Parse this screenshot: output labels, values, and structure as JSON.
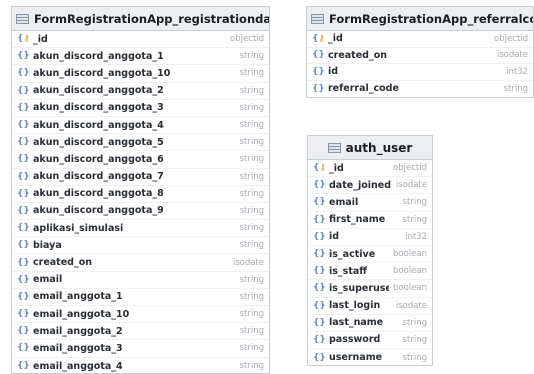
{
  "tables": [
    {
      "id": "registration",
      "title": "FormRegistrationApp_registrationdata",
      "fields": [
        {
          "name": "_id",
          "type": "objectid",
          "icon": "key-icon"
        },
        {
          "name": "akun_discord_anggota_1",
          "type": "string",
          "icon": "braces-icon"
        },
        {
          "name": "akun_discord_anggota_10",
          "type": "string",
          "icon": "braces-icon"
        },
        {
          "name": "akun_discord_anggota_2",
          "type": "string",
          "icon": "braces-icon"
        },
        {
          "name": "akun_discord_anggota_3",
          "type": "string",
          "icon": "braces-icon"
        },
        {
          "name": "akun_discord_anggota_4",
          "type": "string",
          "icon": "braces-icon"
        },
        {
          "name": "akun_discord_anggota_5",
          "type": "string",
          "icon": "braces-icon"
        },
        {
          "name": "akun_discord_anggota_6",
          "type": "string",
          "icon": "braces-icon"
        },
        {
          "name": "akun_discord_anggota_7",
          "type": "string",
          "icon": "braces-icon"
        },
        {
          "name": "akun_discord_anggota_8",
          "type": "string",
          "icon": "braces-icon"
        },
        {
          "name": "akun_discord_anggota_9",
          "type": "string",
          "icon": "braces-icon"
        },
        {
          "name": "aplikasi_simulasi",
          "type": "string",
          "icon": "braces-icon"
        },
        {
          "name": "biaya",
          "type": "string",
          "icon": "braces-icon"
        },
        {
          "name": "created_on",
          "type": "isodate",
          "icon": "braces-icon"
        },
        {
          "name": "email",
          "type": "string",
          "icon": "braces-icon"
        },
        {
          "name": "email_anggota_1",
          "type": "string",
          "icon": "braces-icon"
        },
        {
          "name": "email_anggota_10",
          "type": "string",
          "icon": "braces-icon"
        },
        {
          "name": "email_anggota_2",
          "type": "string",
          "icon": "braces-icon"
        },
        {
          "name": "email_anggota_3",
          "type": "string",
          "icon": "braces-icon"
        },
        {
          "name": "email_anggota_4",
          "type": "string",
          "icon": "braces-icon"
        }
      ]
    },
    {
      "id": "referral",
      "title": "FormRegistrationApp_referralcode",
      "fields": [
        {
          "name": "_id",
          "type": "objectid",
          "icon": "key-icon"
        },
        {
          "name": "created_on",
          "type": "isodate",
          "icon": "braces-icon"
        },
        {
          "name": "id",
          "type": "int32",
          "icon": "braces-icon"
        },
        {
          "name": "referral_code",
          "type": "string",
          "icon": "braces-icon"
        }
      ]
    },
    {
      "id": "auth_user",
      "title": "auth_user",
      "fields": [
        {
          "name": "_id",
          "type": "objectid",
          "icon": "key-icon"
        },
        {
          "name": "date_joined",
          "type": "isodate",
          "icon": "braces-icon"
        },
        {
          "name": "email",
          "type": "string",
          "icon": "braces-icon"
        },
        {
          "name": "first_name",
          "type": "string",
          "icon": "braces-icon"
        },
        {
          "name": "id",
          "type": "int32",
          "icon": "braces-icon"
        },
        {
          "name": "is_active",
          "type": "boolean",
          "icon": "braces-icon"
        },
        {
          "name": "is_staff",
          "type": "boolean",
          "icon": "braces-icon"
        },
        {
          "name": "is_superuser",
          "type": "boolean",
          "icon": "braces-icon"
        },
        {
          "name": "last_login",
          "type": "isodate",
          "icon": "braces-icon"
        },
        {
          "name": "last_name",
          "type": "string",
          "icon": "braces-icon"
        },
        {
          "name": "password",
          "type": "string",
          "icon": "braces-icon"
        },
        {
          "name": "username",
          "type": "string",
          "icon": "braces-icon"
        }
      ]
    }
  ]
}
